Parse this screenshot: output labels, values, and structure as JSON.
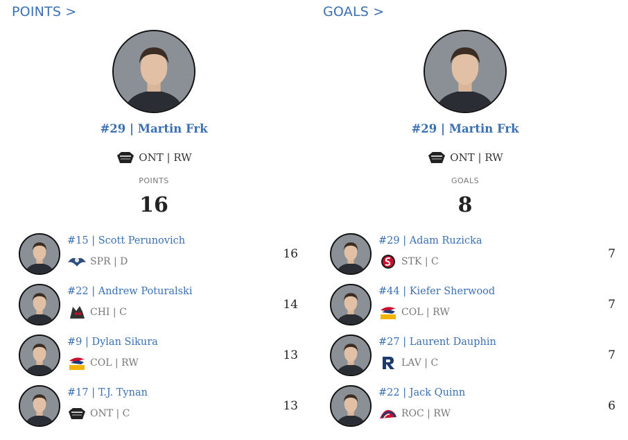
{
  "points": {
    "link_label": "POINTS >",
    "leader": {
      "name": "#29 | Martin Frk",
      "team": "ONT | RW",
      "logo_icon": "ontario-reign-logo-icon",
      "stat_label": "POINTS",
      "stat_value": "16"
    },
    "others": [
      {
        "name": "#15 | Scott Perunovich",
        "team": "SPR | D",
        "logo_icon": "springfield-thunderbirds-logo-icon",
        "value": "16"
      },
      {
        "name": "#22 | Andrew Poturalski",
        "team": "CHI | C",
        "logo_icon": "chicago-wolves-logo-icon",
        "value": "14"
      },
      {
        "name": "#9 | Dylan Sikura",
        "team": "COL | RW",
        "logo_icon": "colorado-eagles-logo-icon",
        "value": "13"
      },
      {
        "name": "#17 | T.J. Tynan",
        "team": "ONT | C",
        "logo_icon": "ontario-reign-logo-icon",
        "value": "13"
      }
    ]
  },
  "goals": {
    "link_label": "GOALS >",
    "leader": {
      "name": "#29 | Martin Frk",
      "team": "ONT | RW",
      "logo_icon": "ontario-reign-logo-icon",
      "stat_label": "GOALS",
      "stat_value": "8"
    },
    "others": [
      {
        "name": "#29 | Adam Ruzicka",
        "team": "STK | C",
        "logo_icon": "stockton-heat-logo-icon",
        "value": "7"
      },
      {
        "name": "#44 | Kiefer Sherwood",
        "team": "COL | RW",
        "logo_icon": "colorado-eagles-logo-icon",
        "value": "7"
      },
      {
        "name": "#27 | Laurent Dauphin",
        "team": "LAV | C",
        "logo_icon": "laval-rocket-logo-icon",
        "value": "7"
      },
      {
        "name": "#22 | Jack Quinn",
        "team": "ROC | RW",
        "logo_icon": "rochester-americans-logo-icon",
        "value": "6"
      }
    ]
  },
  "colors": {
    "link": "#3a70b3",
    "text": "#222222",
    "muted": "#777777",
    "photo_border": "#111111"
  }
}
